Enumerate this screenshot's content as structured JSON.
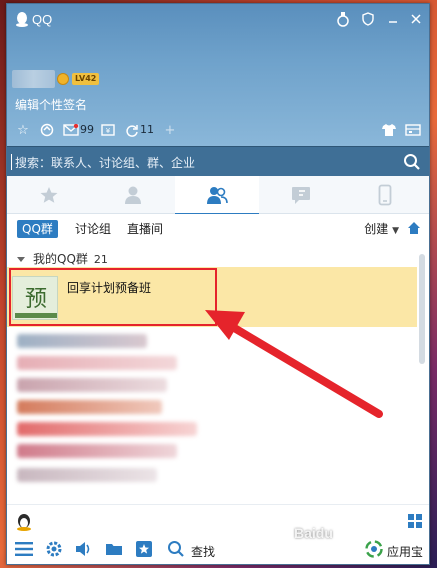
{
  "app": {
    "title": "QQ"
  },
  "profile": {
    "level_badge": "LV42",
    "signature_placeholder": "编辑个性签名",
    "mail_count": "99",
    "notif_count": "11"
  },
  "search": {
    "placeholder": "搜索：联系人、讨论组、群、企业"
  },
  "tabs": [
    "favorites-tab",
    "contacts-tab",
    "groups-tab",
    "messages-tab",
    "devices-tab"
  ],
  "subtabs": {
    "qq_group": "QQ群",
    "discussion": "讨论组",
    "live": "直播间",
    "create": "创建"
  },
  "group_list": {
    "header": "我的QQ群",
    "count": "21",
    "selected_group": {
      "name": "回享计划预备班",
      "avatar_text": "预"
    }
  },
  "bottom": {
    "find_label": "查找",
    "app_store_label": "应用宝"
  },
  "watermark": "Baidu",
  "colors": {
    "accent": "#2d7cc1",
    "selected_row": "#fbe7a6",
    "highlight": "#e5242b",
    "header_top": "#5a8fbd"
  }
}
